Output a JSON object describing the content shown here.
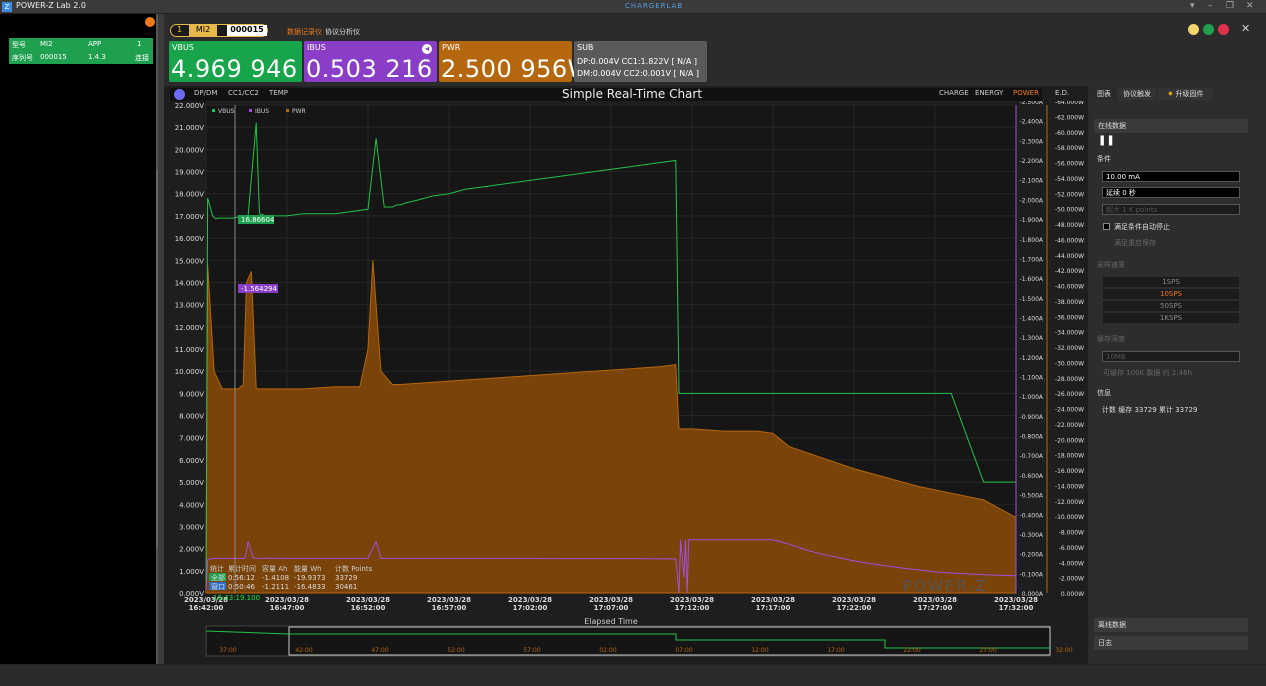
{
  "app": {
    "title": "POWER-Z Lab 2.0",
    "brand": "CHARGERLAB",
    "logo": "Z"
  },
  "left": {
    "col1_row1": "型号",
    "col2_row1": "MI2",
    "col3_row1": "APP",
    "col4_row1": "1",
    "col1_row2": "序列号",
    "col2_row2": "000015",
    "col3_row2": "1.4.3",
    "col4_row2": "连接",
    "bottom": "..."
  },
  "device_tab": {
    "index": "1",
    "model": "MI2",
    "serial": "000015"
  },
  "mode_tabs": [
    "数据记录仪",
    "协议分析仪"
  ],
  "cards": {
    "vbus": {
      "label": "VBUS",
      "value": "4.969 946 V"
    },
    "ibus": {
      "label": "IBUS",
      "value": "0.503 216 A"
    },
    "pwr": {
      "label": "PWR",
      "value": "2.500 956W"
    },
    "sub": {
      "label": "SUB",
      "line1": "DP:0.004V  CC1:1.822V [ N/A ]",
      "line2": "DM:0.004V  CC2:0.001V [ N/A ]"
    }
  },
  "chart_tabs_left": [
    "DP/DM",
    "CC1/CC2",
    "TEMP"
  ],
  "chart_tabs_right": [
    "CHARGE",
    "ENERGY",
    "POWER",
    "E.D."
  ],
  "chart_data": {
    "type": "line",
    "title": "Simple Real-Time Chart",
    "xlabel": "Elapsed Time",
    "x_ticks": [
      "2023/03/28 16:42:00",
      "2023/03/28 16:47:00",
      "2023/03/28 16:52:00",
      "2023/03/28 16:57:00",
      "2023/03/28 17:02:00",
      "2023/03/28 17:07:00",
      "2023/03/28 17:12:00",
      "2023/03/28 17:17:00",
      "2023/03/28 17:22:00",
      "2023/03/28 17:27:00",
      "2023/03/28 17:32:00"
    ],
    "y_left_ticks": [
      "0.000V",
      "1.000V",
      "2.000V",
      "3.000V",
      "4.000V",
      "5.000V",
      "6.000V",
      "7.000V",
      "8.000V",
      "9.000V",
      "10.000V",
      "11.000V",
      "12.000V",
      "13.000V",
      "14.000V",
      "15.000V",
      "16.000V",
      "17.000V",
      "18.000V",
      "19.000V",
      "20.000V",
      "21.000V",
      "22.000V"
    ],
    "y_mid_ticks": [
      "0.000A",
      "-0.100A",
      "-0.200A",
      "-0.300A",
      "-0.400A",
      "-0.500A",
      "-0.600A",
      "-0.700A",
      "-0.800A",
      "-0.900A",
      "-1.000A",
      "-1.100A",
      "-1.200A",
      "-1.300A",
      "-1.400A",
      "-1.500A",
      "-1.600A",
      "-1.700A",
      "-1.800A",
      "-1.900A",
      "-2.000A",
      "-2.100A",
      "-2.200A",
      "-2.300A",
      "-2.400A",
      "-2.500A"
    ],
    "y_right_ticks": [
      "0.000W",
      "-2.000W",
      "-4.000W",
      "-6.000W",
      "-8.000W",
      "-10.000W",
      "-12.000W",
      "-14.000W",
      "-16.000W",
      "-18.000W",
      "-20.000W",
      "-22.000W",
      "-24.000W",
      "-26.000W",
      "-28.000W",
      "-30.000W",
      "-32.000W",
      "-34.000W",
      "-36.000W",
      "-38.000W",
      "-40.000W",
      "-42.000W",
      "-44.000W",
      "-46.000W",
      "-48.000W",
      "-50.000W",
      "-52.000W",
      "-54.000W",
      "-56.000W",
      "-58.000W",
      "-60.000W",
      "-62.000W",
      "-64.000W"
    ],
    "ylim_left": [
      0,
      22
    ],
    "legend": [
      "VBUS",
      "IBUS",
      "PWR"
    ],
    "series": [
      {
        "name": "VBUS",
        "color": "#22c34a",
        "x": [
          0,
          0.1,
          0.3,
          0.4,
          0.6,
          0.7,
          1.0,
          1.3,
          1.7,
          2.0,
          2.6,
          3.1,
          3.3,
          3.7,
          4.2,
          5.0,
          6.0,
          7.0,
          8.0,
          9.0,
          10.0,
          10.5,
          11.0,
          11.2,
          11.5,
          11.8,
          12.0,
          12.4,
          13.0,
          14.0,
          15.0,
          16.0,
          17.0,
          19.0,
          20.0,
          22.0,
          24.0,
          26.0,
          28.0,
          29.0,
          29.2,
          31.5,
          31.6,
          34,
          36,
          38,
          40,
          42,
          44,
          46,
          48,
          49.8,
          50
        ],
        "y": [
          0.1,
          17.8,
          17.3,
          17.0,
          16.87,
          16.9,
          16.9,
          16.9,
          16.9,
          16.95,
          17.0,
          21.2,
          17.1,
          17.0,
          17.0,
          17.0,
          17.1,
          17.1,
          17.1,
          17.2,
          17.3,
          20.5,
          17.4,
          17.4,
          17.4,
          17.5,
          17.5,
          17.6,
          17.7,
          17.9,
          18.0,
          18.2,
          18.3,
          18.5,
          18.6,
          18.8,
          19.0,
          19.2,
          19.4,
          19.5,
          9.0,
          9.0,
          9.0,
          9.0,
          9.0,
          9.0,
          9.0,
          9.0,
          9.0,
          9.0,
          5.0,
          5.0,
          5.0
        ]
      },
      {
        "name": "IBUS",
        "color": "#a54ee0",
        "x": [
          0,
          0.1,
          0.3,
          0.5,
          0.8,
          1.2,
          1.8,
          2.4,
          2.6,
          2.9,
          3.0,
          3.2,
          3.5,
          3.9,
          4.5,
          6,
          8,
          10,
          10.5,
          10.8,
          11.0,
          12,
          14,
          16,
          18,
          20,
          22,
          24,
          26,
          28,
          29,
          29.2,
          29.3,
          29.5,
          29.6,
          29.7,
          29.8,
          30,
          32,
          34,
          35,
          35.5,
          36,
          37,
          38,
          39,
          40,
          41,
          42,
          43,
          44,
          45,
          46,
          47,
          48,
          49,
          50
        ],
        "y": [
          0.1,
          1.5,
          1.55,
          1.56,
          1.56,
          1.56,
          1.56,
          1.56,
          2.32,
          1.6,
          1.56,
          1.56,
          1.56,
          1.57,
          1.56,
          1.56,
          1.56,
          1.56,
          2.32,
          1.56,
          1.56,
          1.56,
          1.56,
          1.56,
          1.56,
          1.56,
          1.55,
          1.55,
          1.55,
          1.54,
          1.54,
          0.02,
          2.4,
          0.7,
          2.4,
          0.02,
          2.4,
          2.4,
          2.4,
          2.4,
          2.4,
          2.3,
          2.2,
          1.95,
          1.75,
          1.6,
          1.45,
          1.33,
          1.22,
          1.12,
          1.04,
          0.95,
          0.9,
          0.86,
          0.82,
          0.8,
          0.78
        ]
      },
      {
        "name": "PWR",
        "color": "#b5670d",
        "x": [
          0,
          0.1,
          0.5,
          1.0,
          2.0,
          2.3,
          2.5,
          2.8,
          3.1,
          3.3,
          4,
          6,
          8,
          9.5,
          10,
          10.3,
          10.8,
          11.5,
          12,
          14,
          16,
          18,
          20,
          22,
          24,
          26,
          28,
          29,
          29.2,
          30,
          32,
          34,
          35,
          35.5,
          36,
          38,
          40,
          42,
          44,
          46,
          48,
          49,
          50
        ],
        "y": [
          0.1,
          14.8,
          10.0,
          9.2,
          9.2,
          9.4,
          14.0,
          14.5,
          9.2,
          9.2,
          9.2,
          9.2,
          9.3,
          9.3,
          11.0,
          15.0,
          10.0,
          9.4,
          9.4,
          9.5,
          9.6,
          9.7,
          9.8,
          9.9,
          10.0,
          10.1,
          10.2,
          10.3,
          7.4,
          7.4,
          7.3,
          7.3,
          7.2,
          6.9,
          6.6,
          6.1,
          5.6,
          5.2,
          4.8,
          4.5,
          4.2,
          3.8,
          3.4
        ]
      }
    ],
    "x_range": [
      0,
      50
    ],
    "markers": [
      {
        "label": "16.86604",
        "series": "VBUS"
      },
      {
        "label": "-1.564294",
        "series": "IBUS"
      }
    ],
    "watermark": "POWER-Z",
    "stats": {
      "headers": [
        "统计",
        "累计时间",
        "容量 Ah",
        "能量 Wh",
        "计数 Points"
      ],
      "rows": [
        [
          "全部",
          "0:56:12",
          "-1.4108",
          "-19.9373",
          "33729"
        ],
        [
          "窗口",
          "0:50:46",
          "-1.2111",
          "-16.4833",
          "30461"
        ]
      ]
    },
    "cursor_time": "16:43:19.100",
    "overview_ticks": [
      "37:00",
      "42:00",
      "47:00",
      "52:00",
      "57:00",
      "02:00",
      "07:00",
      "12:00",
      "17:00",
      "22:00",
      "27:00",
      "32:00"
    ]
  },
  "right": {
    "tabs": [
      "图表",
      "协议触发",
      "升级固件"
    ],
    "online_data": "在线数据",
    "pause": "❚❚",
    "condition": "条件",
    "current": "10.00 mA",
    "delay": "延续 0 秒",
    "points": "超大 1 K points",
    "auto_stop": "满足条件自动停止",
    "auto_save": "满足重启保存",
    "sample_rate": "采样速率",
    "rates": [
      "1SPS",
      "10SPS",
      "50SPS",
      "1KSPS"
    ],
    "cache": "缓存深度",
    "cache_val": "10MB",
    "cache_info": "可缓存 100K 数据 约 2:46h",
    "info": "信息",
    "info_text": "计数 缓存 33729 累计 33729",
    "offline": "离线数据",
    "log": "日志",
    "accent": "#f07a18"
  }
}
